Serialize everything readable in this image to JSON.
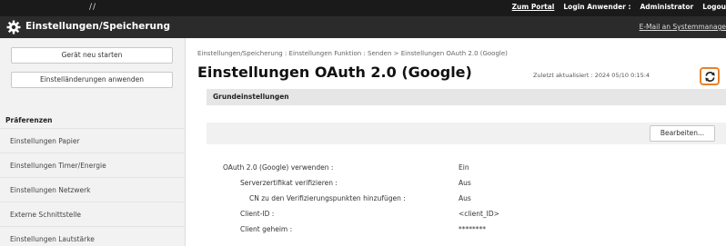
{
  "topbar": {
    "slashes": "//",
    "portal_link": "Zum Portal",
    "login_label": "Login Anwender :",
    "user": "Administrator",
    "logout": "Logou"
  },
  "titlebar": {
    "title": "Einstellungen/Speicherung",
    "mail_link": "E-Mail an Systemmanage"
  },
  "sidebar": {
    "restart_button": "Gerät neu starten",
    "apply_button": "Einstelländerungen anwenden",
    "section_heading": "Präferenzen",
    "items": [
      "Einstellungen Papier",
      "Einstellungen Timer/Energie",
      "Einstellungen Netzwerk",
      "Externe Schnittstelle",
      "Einstellungen Lautstärke"
    ]
  },
  "main": {
    "breadcrumb": "Einstellungen/Speicherung : Einstellungen Funktion : Senden > Einstellungen OAuth 2.0 (Google)",
    "title": "Einstellungen OAuth 2.0 (Google)",
    "last_updated": "Zuletzt aktualisiert : 2024 05/10 0:15:4",
    "section_title": "Grundeinstellungen",
    "edit_button": "Bearbeiten...",
    "rows": [
      {
        "label": "OAuth 2.0 (Google) verwenden :",
        "value": "Ein"
      },
      {
        "label": "Serverzertifikat verifizieren :",
        "value": "Aus"
      },
      {
        "label": "CN zu den Verifizierungspunkten hinzufügen :",
        "value": "Aus"
      },
      {
        "label": "Client-ID :",
        "value": "<client_ID>"
      },
      {
        "label": "Client geheim :",
        "value": "********"
      }
    ]
  },
  "colors": {
    "topbar": "#1a1a1a",
    "titlebar": "#2b2b2b",
    "refresh_highlight": "#e8822a"
  }
}
